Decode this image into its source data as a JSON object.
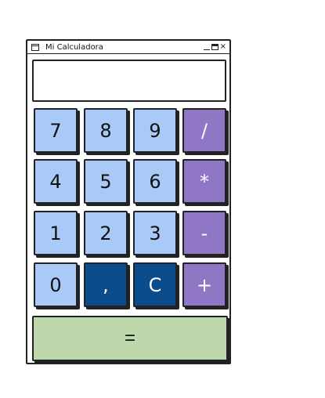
{
  "window": {
    "title": "Mi Calculadora",
    "close_glyph": "×"
  },
  "display": {
    "value": ""
  },
  "keys": {
    "k7": "7",
    "k8": "8",
    "k9": "9",
    "div": "/",
    "k4": "4",
    "k5": "5",
    "k6": "6",
    "mul": "*",
    "k1": "1",
    "k2": "2",
    "k3": "3",
    "sub": "-",
    "k0": "0",
    "comma": ",",
    "clear": "C",
    "add": "+",
    "equals": "="
  },
  "colors": {
    "number_key": "#a9c9f7",
    "operator_key": "#8f77c5",
    "dark_key": "#0b4c8c",
    "equals_key": "#bcd8ac"
  }
}
